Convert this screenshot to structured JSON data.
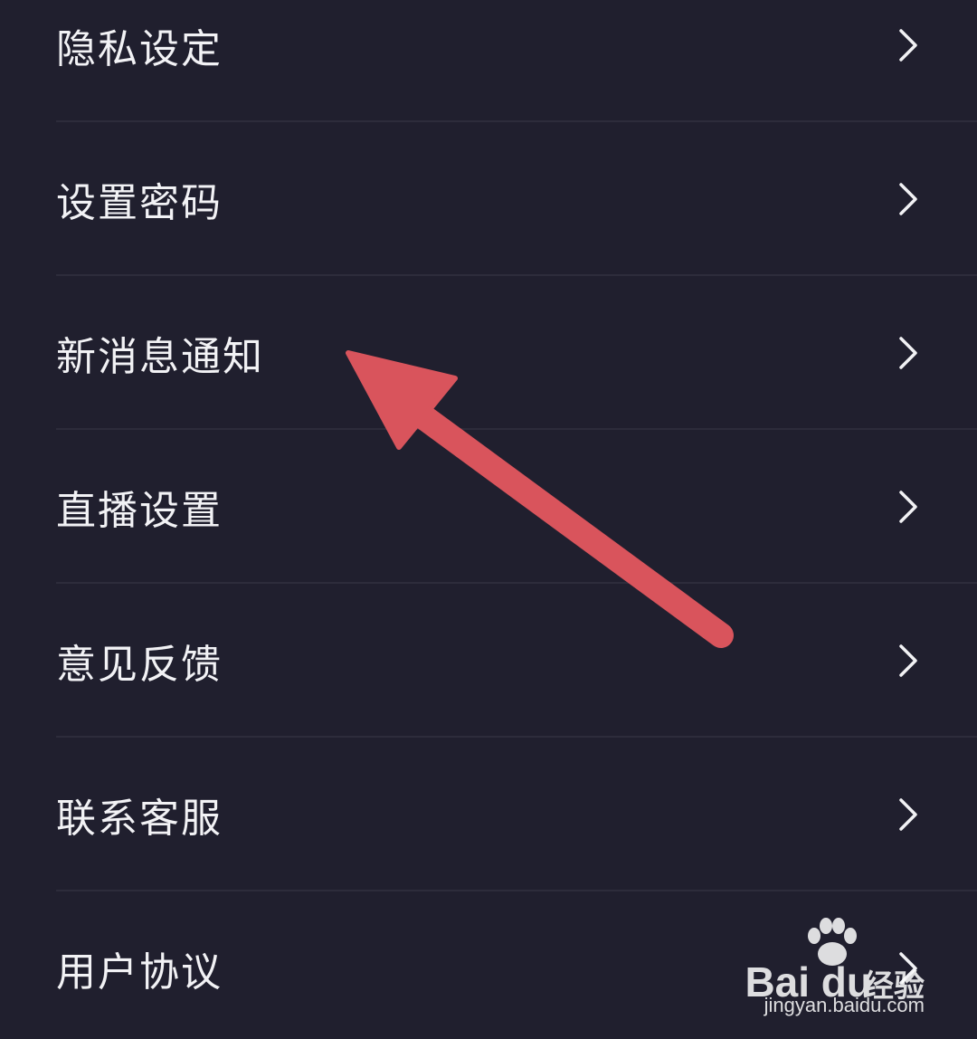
{
  "settings": {
    "items": [
      {
        "label": "隐私设定"
      },
      {
        "label": "设置密码"
      },
      {
        "label": "新消息通知"
      },
      {
        "label": "直播设置"
      },
      {
        "label": "意见反馈"
      },
      {
        "label": "联系客服"
      },
      {
        "label": "用户协议"
      }
    ]
  },
  "annotation": {
    "color": "#d9545c",
    "target": "新消息通知"
  },
  "watermark": {
    "logo_text": "Bai du",
    "product": "经验",
    "url": "jingyan.baidu.com"
  },
  "colors": {
    "background": "#201f2e",
    "text": "#f2f2f5",
    "divider": "#2d2c3b"
  }
}
